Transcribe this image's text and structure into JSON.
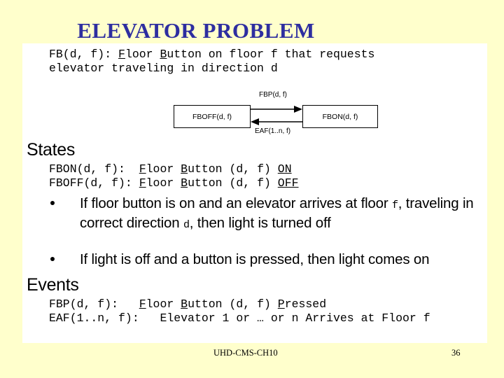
{
  "slide": {
    "title": "ELEVATOR PROBLEM",
    "background_color": "#FFFFCC",
    "panel_color": "#FFFFFF",
    "title_color": "#2E2EA0"
  },
  "intro": {
    "line1_prefix": "FB(d, f): ",
    "line1_f": "F",
    "line1_mid1": "loor ",
    "line1_b": "B",
    "line1_mid2": "utton on floor f that requests",
    "line2": "elevator traveling in direction d"
  },
  "diagram": {
    "state_off": "FBOFF(d, f)",
    "state_on": "FBON(d, f)",
    "transition_forward": "FBP(d, f)",
    "transition_back": "EAF(1..n, f)"
  },
  "states": {
    "heading": "States",
    "rows": [
      {
        "name": "FBON(d, f):  ",
        "f": "F",
        "mid1": "loor ",
        "b": "B",
        "mid2": "utton (d, f) ",
        "value": "ON"
      },
      {
        "name": "FBOFF(d, f): ",
        "f": "F",
        "mid1": "loor ",
        "b": "B",
        "mid2": "utton (d, f) ",
        "value": "OFF"
      }
    ]
  },
  "bullets": [
    {
      "part1": "If floor button is on and an elevator arrives at floor ",
      "var1": "f",
      "part2": ", traveling in correct direction ",
      "var2": "d",
      "part3": ", then light is turned off"
    },
    {
      "part1": "If light is off and a button is pressed, then light comes on",
      "var1": "",
      "part2": "",
      "var2": "",
      "part3": ""
    }
  ],
  "events": {
    "heading": "Events",
    "fbp": {
      "name": "FBP(d, f):   ",
      "f": "F",
      "mid1": "loor ",
      "b": "B",
      "mid2": "utton (d, f) ",
      "p": "P",
      "tail": "ressed"
    },
    "eaf": {
      "name": "EAF(1..n, f):   ",
      "text": "Elevator 1 or … or n Arrives at Floor f"
    }
  },
  "footer": {
    "source": "UHD-CMS-CH10",
    "page_number": "36"
  }
}
